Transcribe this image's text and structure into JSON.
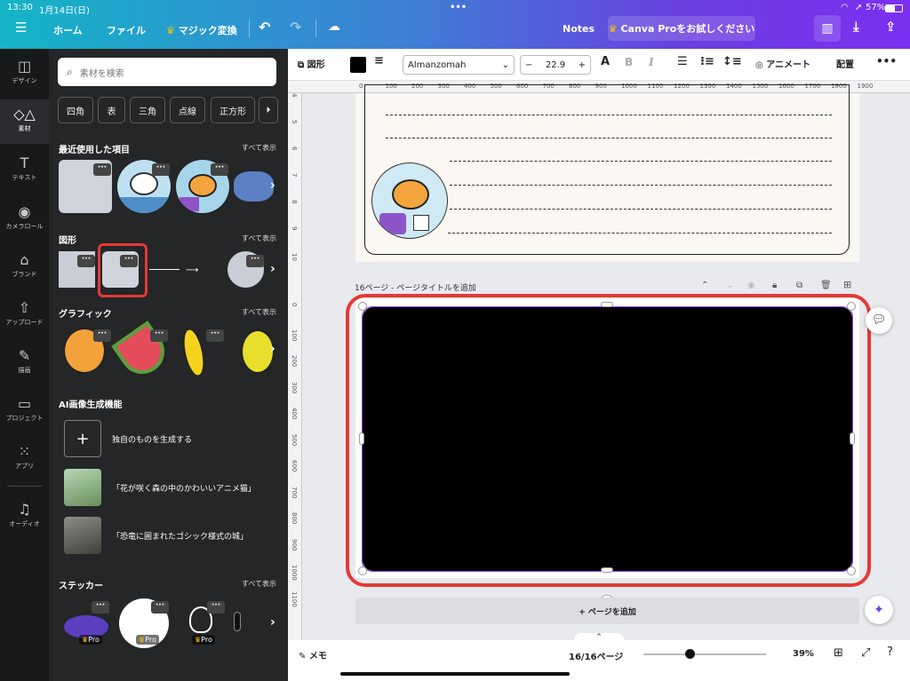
{
  "status_bar": {
    "time": "13:30",
    "date": "1月14日(日)",
    "battery": "57%"
  },
  "header": {
    "menu_icon": "hamburger-icon",
    "home": "ホーム",
    "file": "ファイル",
    "magic": "マジック変換",
    "notes": "Notes",
    "pro_trial": "Canva Proをお試しください"
  },
  "rail": [
    {
      "icon": "layout-icon",
      "label": "デザイン"
    },
    {
      "icon": "elements-icon",
      "label": "素材",
      "active": true
    },
    {
      "icon": "text-icon",
      "label": "テキスト"
    },
    {
      "icon": "camera-icon",
      "label": "カメラロール"
    },
    {
      "icon": "brand-icon",
      "label": "ブランド"
    },
    {
      "icon": "upload-icon",
      "label": "アップロード"
    },
    {
      "icon": "draw-icon",
      "label": "描画"
    },
    {
      "icon": "folder-icon",
      "label": "プロジェクト"
    },
    {
      "icon": "apps-icon",
      "label": "アプリ"
    },
    {
      "icon": "music-icon",
      "label": "オーディオ"
    }
  ],
  "panel": {
    "search_placeholder": "素材を検索",
    "chips": [
      "四角",
      "表",
      "三角",
      "点線",
      "正方形"
    ],
    "see_all": "すべて表示",
    "recent_title": "最近使用した項目",
    "shapes_title": "図形",
    "graphics_title": "グラフィック",
    "ai_title": "AI画像生成機能",
    "ai_items": [
      {
        "label": "独自のものを生成する"
      },
      {
        "label": "「花が咲く森の中のかわいいアニメ猫」"
      },
      {
        "label": "「恐竜に囲まれたゴシック様式の城」"
      }
    ],
    "stickers_title": "ステッカー",
    "pro_label": "Pro"
  },
  "toolbar": {
    "shape": "図形",
    "font": "Almanzomah",
    "font_size": "22.9",
    "animate": "アニメート",
    "position": "配置",
    "bold": "B",
    "italic": "I",
    "minus": "−",
    "plus": "+"
  },
  "ruler": {
    "h": [
      "0",
      "100",
      "200",
      "300",
      "400",
      "500",
      "600",
      "700",
      "800",
      "900",
      "1000",
      "1100",
      "1200",
      "1300",
      "1400",
      "1500",
      "1600",
      "1700",
      "1800",
      "1900"
    ],
    "v_top": [
      "4",
      "5",
      "6",
      "7",
      "8",
      "9",
      "10"
    ],
    "v": [
      "0",
      "100",
      "200",
      "300",
      "400",
      "500",
      "600",
      "700",
      "800",
      "900",
      "1000",
      "1100"
    ]
  },
  "page": {
    "label": "16ページ - ページタイトルを追加",
    "add_page": "+ ページを追加"
  },
  "bottom": {
    "notes": "メモ",
    "pages": "16/16ページ",
    "zoom": "39%",
    "zoom_level": 0.25
  },
  "colors": {
    "accent_red": "#e53935",
    "selection": "#8b3dff",
    "fill": "#000000"
  }
}
